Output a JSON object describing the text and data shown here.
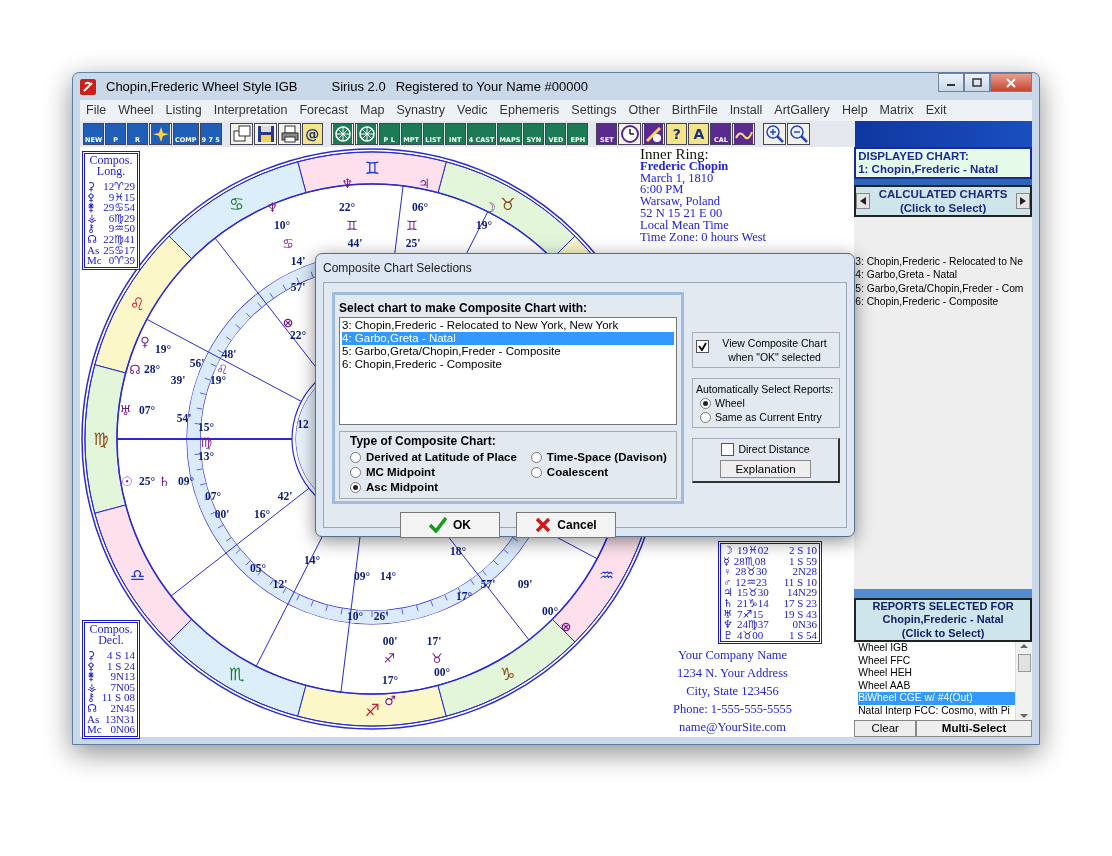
{
  "window": {
    "title": "Chopin,Frederic Wheel Style IGB",
    "app": "Sirius 2.0",
    "registration": "Registered to Your Name  #00000"
  },
  "menu": [
    "File",
    "Wheel",
    "Listing",
    "Interpretation",
    "Forecast",
    "Map",
    "Synastry",
    "Vedic",
    "Ephemeris",
    "Settings",
    "Other",
    "BirthFile",
    "Install",
    "ArtGallery",
    "Help",
    "Matrix",
    "Exit"
  ],
  "toolbar": [
    [
      {
        "kind": "chart",
        "label": "NEW"
      },
      {
        "kind": "chart",
        "label": "P"
      },
      {
        "kind": "chart",
        "label": "R"
      },
      {
        "kind": "star"
      },
      {
        "kind": "chart",
        "label": "COMP"
      },
      {
        "kind": "chart",
        "label": "9 7 5"
      }
    ],
    [
      {
        "kind": "windows"
      },
      {
        "kind": "save"
      },
      {
        "kind": "print"
      },
      {
        "kind": "note",
        "label": "@"
      }
    ],
    [
      {
        "kind": "wheel"
      },
      {
        "kind": "wheel"
      },
      {
        "kind": "report",
        "label": "P L"
      },
      {
        "kind": "report",
        "label": "MPT"
      },
      {
        "kind": "report",
        "label": "LIST"
      },
      {
        "kind": "report",
        "label": "INT"
      },
      {
        "kind": "report",
        "label": "4 CAST"
      },
      {
        "kind": "report",
        "label": "MAPS"
      },
      {
        "kind": "report",
        "label": "SYN"
      },
      {
        "kind": "report",
        "label": "VED"
      },
      {
        "kind": "report",
        "label": "EPH"
      }
    ],
    [
      {
        "kind": "tool",
        "label": "SET"
      },
      {
        "kind": "clock"
      },
      {
        "kind": "pen"
      },
      {
        "kind": "note",
        "label": "?"
      },
      {
        "kind": "note",
        "label": "A"
      },
      {
        "kind": "tool",
        "label": "CAL"
      },
      {
        "kind": "wave"
      }
    ],
    [
      {
        "kind": "zoom-in"
      },
      {
        "kind": "zoom-out"
      }
    ]
  ],
  "chart": {
    "signs": [
      "♉",
      "♊",
      "♋",
      "♌",
      "♍",
      "♎",
      "♏",
      "♐",
      "♑",
      "♒"
    ],
    "labels": [
      "♆",
      "♃",
      "♆",
      "22°",
      "06°",
      "☽",
      "10°",
      "♊",
      "♊",
      "19°",
      "♋",
      "44'",
      "25'",
      "14'",
      "57'",
      "⊗",
      "22°",
      "♀",
      "19°",
      "48'",
      "56'",
      "☊",
      "28°",
      "♌",
      "39'",
      "19°",
      "♅",
      "07°",
      "54'",
      "12",
      "15°",
      "♍",
      "13°",
      "☉",
      "25°",
      "♄",
      "09°",
      "07°",
      "42'",
      "00'",
      "16°",
      "18°",
      "14°",
      "05°",
      "09°",
      "14°",
      "12'",
      "57'",
      "09'",
      "17°",
      "00°",
      "10°",
      "26'",
      "⊗",
      "00'",
      "17'",
      "♐",
      "♉",
      "00°",
      "17°",
      "♂"
    ]
  },
  "compos_long": {
    "title": "Compos.",
    "subtitle": "Long.",
    "rows": [
      {
        "glyph": "⚳",
        "value": "12♈29"
      },
      {
        "glyph": "⚴",
        "value": "9♓15"
      },
      {
        "glyph": "⚵",
        "value": "29♋54"
      },
      {
        "glyph": "⚶",
        "value": "6♍29"
      },
      {
        "glyph": "⚷",
        "value": "9♒50"
      },
      {
        "glyph": "☊",
        "value": "22♍41"
      },
      {
        "glyph": "As",
        "value": "25♋17"
      },
      {
        "glyph": "Mc",
        "value": "0♈39"
      }
    ]
  },
  "compos_decl": {
    "title": "Compos.",
    "subtitle": "Decl.",
    "rows": [
      {
        "glyph": "⚳",
        "value": "4 S 14"
      },
      {
        "glyph": "⚴",
        "value": "1 S 24"
      },
      {
        "glyph": "⚵",
        "value": "9N13"
      },
      {
        "glyph": "⚶",
        "value": "7N05"
      },
      {
        "glyph": "⚷",
        "value": "11 S 08"
      },
      {
        "glyph": "☊",
        "value": "2N45"
      },
      {
        "glyph": "As",
        "value": "13N31"
      },
      {
        "glyph": "Mc",
        "value": "0N06"
      }
    ]
  },
  "positions": [
    {
      "glyph": "☽",
      "long": "19♓02",
      "decl": "2 S 10"
    },
    {
      "glyph": "☿",
      "long": "28♏08",
      "decl": "1 S 59"
    },
    {
      "glyph": "♀",
      "long": "28♉30",
      "decl": "2N28"
    },
    {
      "glyph": "♂",
      "long": "12♒23",
      "decl": "11 S 10"
    },
    {
      "glyph": "♃",
      "long": "15♉30",
      "decl": "14N29"
    },
    {
      "glyph": "♄",
      "long": "21♑14",
      "decl": "17 S 23"
    },
    {
      "glyph": "♅",
      "long": "7♐15",
      "decl": "19 S 43"
    },
    {
      "glyph": "♆",
      "long": "24♍37",
      "decl": "0N36"
    },
    {
      "glyph": "♇",
      "long": "4♉00",
      "decl": "1 S 54"
    }
  ],
  "info": {
    "heading": "Inner Ring:",
    "name": "Frederic Chopin",
    "lines": [
      "March 1, 1810",
      "6:00 PM",
      "Warsaw, Poland",
      "52 N 15    21 E 00",
      "Local Mean Time",
      "Time Zone: 0 hours West"
    ]
  },
  "company": [
    "Your Company Name",
    "1234 N. Your Address",
    "City, State 123456",
    "Phone: 1-555-555-5555",
    "name@YourSite.com"
  ],
  "displayed_chart": {
    "heading": "DISPLAYED CHART:",
    "value": "1: Chopin,Frederic - Natal"
  },
  "calculated_charts": {
    "heading": "CALCULATED CHARTS",
    "hint": "(Click to Select)",
    "items": [
      {
        "label": "3: Chopin,Frederic - Relocated to Ne",
        "selected": false
      },
      {
        "label": "4: Garbo,Greta - Natal",
        "selected": false
      },
      {
        "label": "5: Garbo,Greta/Chopin,Freder - Com",
        "selected": false
      },
      {
        "label": "6: Chopin,Frederic - Composite",
        "selected": false
      }
    ]
  },
  "reports": {
    "heading": "REPORTS SELECTED FOR",
    "chart": "Chopin,Frederic - Natal",
    "hint": "(Click to Select)",
    "items": [
      {
        "label": "Wheel IGB",
        "selected": false
      },
      {
        "label": "Wheel FFC",
        "selected": false
      },
      {
        "label": "Wheel HEH",
        "selected": false
      },
      {
        "label": "Wheel AAB",
        "selected": false
      },
      {
        "label": "BiWheel CGE w/ #4(Out)",
        "selected": true
      },
      {
        "label": "Natal Interp FCC: Cosmo, with Pi",
        "selected": false
      }
    ],
    "buttons": [
      "Clear",
      "Multi-Select"
    ]
  },
  "dialog": {
    "title": "Composite Chart Selections",
    "list_label": "Select chart to make Composite Chart with:",
    "charts": [
      {
        "label": "3: Chopin,Frederic - Relocated to New York, New York",
        "selected": false
      },
      {
        "label": "4: Garbo,Greta - Natal",
        "selected": true
      },
      {
        "label": "5: Garbo,Greta/Chopin,Freder - Composite",
        "selected": false
      },
      {
        "label": "6: Chopin,Frederic - Composite",
        "selected": false
      }
    ],
    "type_label": "Type of Composite Chart:",
    "types": [
      {
        "label": "Derived at Latitude of Place",
        "selected": false
      },
      {
        "label": "Time-Space (Davison)",
        "selected": false
      },
      {
        "label": "MC Midpoint",
        "selected": false
      },
      {
        "label": "Coalescent",
        "selected": false
      },
      {
        "label": "Asc Midpoint",
        "selected": true
      }
    ],
    "view_composite": {
      "label": "View Composite Chart when \"OK\" selected",
      "checked": true
    },
    "reports_label": "Automatically Select Reports:",
    "report_options": [
      {
        "label": "Wheel",
        "selected": true
      },
      {
        "label": "Same as Current Entry",
        "selected": false
      }
    ],
    "direct_distance": {
      "label": "Direct Distance",
      "checked": false
    },
    "explanation": "Explanation",
    "ok": "OK",
    "cancel": "Cancel"
  }
}
